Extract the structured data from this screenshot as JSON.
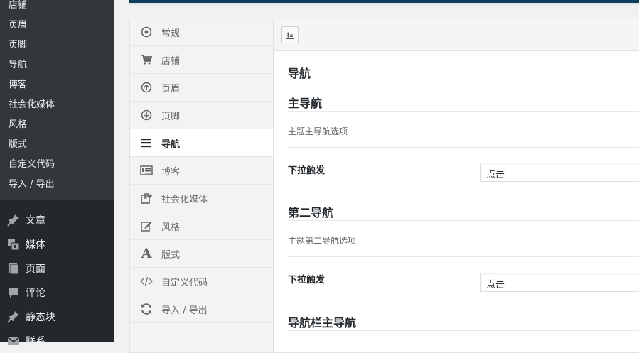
{
  "submenu": {
    "items": [
      "店铺",
      "页眉",
      "页脚",
      "导航",
      "博客",
      "社会化媒体",
      "风格",
      "版式",
      "自定义代码",
      "导入 / 导出"
    ]
  },
  "admin_menu": {
    "items": [
      {
        "label": "文章",
        "icon": "pin-icon"
      },
      {
        "label": "媒体",
        "icon": "media-icon"
      },
      {
        "label": "页面",
        "icon": "page-icon"
      },
      {
        "label": "评论",
        "icon": "comment-icon"
      },
      {
        "label": "静态块",
        "icon": "pin-icon"
      },
      {
        "label": "联系",
        "icon": "mail-icon"
      }
    ]
  },
  "options_nav": {
    "items": [
      {
        "label": "常规",
        "icon": "general-icon"
      },
      {
        "label": "店铺",
        "icon": "cart-icon"
      },
      {
        "label": "页眉",
        "icon": "arrow-up-circle-icon"
      },
      {
        "label": "页脚",
        "icon": "arrow-down-circle-icon"
      },
      {
        "label": "导航",
        "icon": "menu-icon",
        "active": true
      },
      {
        "label": "博客",
        "icon": "blog-icon"
      },
      {
        "label": "社会化媒体",
        "icon": "share-icon"
      },
      {
        "label": "风格",
        "icon": "edit-icon"
      },
      {
        "label": "版式",
        "icon": "typography-icon"
      },
      {
        "label": "自定义代码",
        "icon": "code-icon"
      },
      {
        "label": "导入 / 导出",
        "icon": "refresh-icon"
      }
    ]
  },
  "main": {
    "section_title": "导航",
    "primary_nav": {
      "heading": "主导航",
      "description": "主题主导航选项",
      "field_label": "下拉触发",
      "value": "点击"
    },
    "secondary_nav": {
      "heading": "第二导航",
      "description": "主题第二导航选项",
      "field_label": "下拉触发",
      "value": "点击"
    },
    "navbar_heading": "导航栏主导航"
  }
}
